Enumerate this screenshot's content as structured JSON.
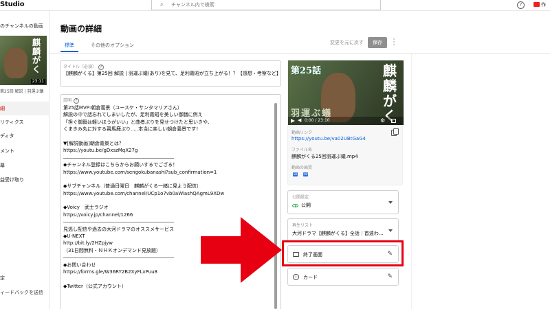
{
  "app": {
    "brand": "Studio"
  },
  "search": {
    "placeholder": "チャンネル内で検索"
  },
  "header": {
    "help_icon": "question-icon",
    "create_label": "作"
  },
  "sidebar": {
    "back_label": "のチャンネルの動画",
    "thumb_text": "麒麟がく",
    "thumb_duration": "23:11",
    "thumb_caption": "第25回 解説 | 羽運ぶ蟻",
    "items": [
      {
        "label": "細",
        "active": true
      },
      {
        "label": "リティクス",
        "active": false
      },
      {
        "label": "ディタ",
        "active": false
      },
      {
        "label": "メント",
        "active": false
      },
      {
        "label": "幕",
        "active": false
      },
      {
        "label": "益受け取り",
        "active": false
      }
    ],
    "settings_label": "定",
    "feedback_label": "ィードバックを送信"
  },
  "page": {
    "title": "動画の詳細"
  },
  "tabs": [
    {
      "label": "標準",
      "active": true
    },
    {
      "label": "その他のオプション",
      "active": false
    }
  ],
  "toolbar": {
    "undo_label": "変更を元に戻す",
    "save_label": "保存"
  },
  "title_field": {
    "label": "タイトル（必須）",
    "value": "【麒麟がくる】第25回 解説 | 羽運ぶ蟻(あり)を見て、足利義昭が立ち上がる！？【感想・考察など】"
  },
  "description": {
    "label": "説明",
    "lines": [
      "第25話MVP:朝倉義景（ユースケ・サンタマリアさん）",
      "解説の中で話忘れてしまいしたが、足利義昭を美しい御膳に例え",
      "「担ぐ御輿は軽いほうがいい」と曲者ぶりを見せつけたと思いきや、",
      "くまきみ丸に対する親馬鹿ぶり.....本当に楽しい朝倉義景です！",
      "",
      "▼[解説動画]朝倉義景とは？",
      "https://youtu.be/gDxszMqX27g",
      "―――――――――――――――――――――――",
      "◆チャンネル登録はこちらからお願いするでござる！",
      "https://www.youtube.com/sengokubanashi?sub_confirmation=1",
      "",
      "◆サブチャンネル（普通日曜日　麒麟がくる一緒に見よう配信）",
      "https://www.youtube.com/channel/UCp1o7vb0aWiashQAgmL9XDw",
      "",
      "◆Voicy　武士ラジオ",
      "https://voicy.jp/channel/1266",
      "―――――――――――――――――――――――",
      "見逃し配信や過去の大河ドラマのオススメサービス",
      "◆U-NEXT",
      "http://bit.ly/2HZpjyw",
      "（31日間無料・ＮＨＫオンデマンド見放題）",
      "―――――――――――――――――――――――",
      "◆お問い合わせ",
      "https://forms.gle/W36RY2B2XyFLxPuu8",
      "",
      "◆Twitter（公式アカウント）"
    ]
  },
  "preview": {
    "episode_text": "第25話",
    "title_text": "麒麟がくる",
    "overlay_text": "羽運ぶ蟻",
    "time": "0:00 / 23:10",
    "link_label": "動画リンク",
    "link": "https://youtu.be/va02UBtGaG4",
    "file_label": "ファイル名",
    "file": "麒麟がくる25回羽運ぶ蟻.mp4",
    "quality_label": "動画の画質",
    "quality_badges": [
      "SD",
      "HD"
    ]
  },
  "visibility": {
    "label": "公開設定",
    "value": "公開"
  },
  "playlist": {
    "label": "再生リスト",
    "value": "大河ドラマ【麒麟がくる】全話｜首遠わ..."
  },
  "end_screen": {
    "label": "終了画面"
  },
  "cards": {
    "label": "カード"
  },
  "colors": {
    "accent": "#065fd4",
    "highlight": "#e60012",
    "visibility": "#2ba640"
  }
}
